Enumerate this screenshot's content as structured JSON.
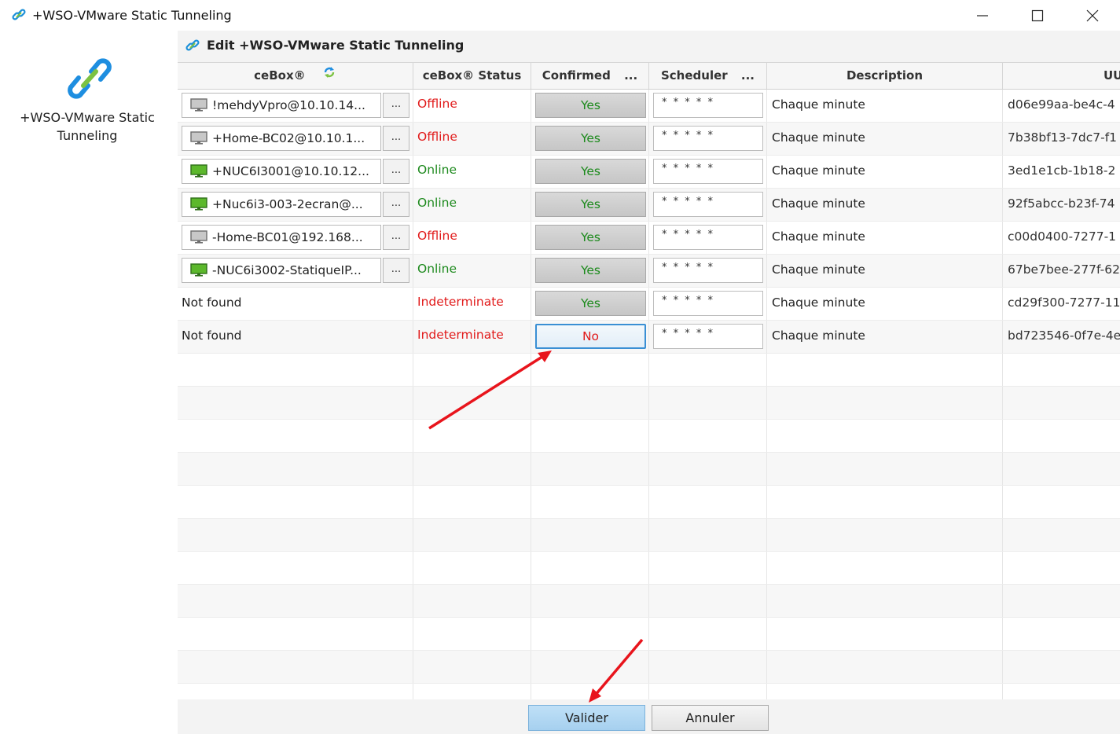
{
  "window": {
    "title": "+WSO-VMware Static Tunneling"
  },
  "sidebar": {
    "label_line1": "+WSO-VMware Static",
    "label_line2": "Tunneling"
  },
  "panel": {
    "title": "Edit +WSO-VMware Static Tunneling"
  },
  "columns": {
    "cebox": "ceBox®",
    "status": "ceBox® Status",
    "confirmed": "Confirmed",
    "scheduler": "Scheduler",
    "description": "Description",
    "uuid": "UU",
    "more": "..."
  },
  "rows": [
    {
      "cebox": "!mehdyVpro@10.10.14...",
      "online": false,
      "status": "Offline",
      "confirmed": "Yes",
      "scheduler": "* * * * *",
      "description": "Chaque minute",
      "uuid": "d06e99aa-be4c-4"
    },
    {
      "cebox": "+Home-BC02@10.10.1...",
      "online": false,
      "status": "Offline",
      "confirmed": "Yes",
      "scheduler": "* * * * *",
      "description": "Chaque minute",
      "uuid": "7b38bf13-7dc7-f1"
    },
    {
      "cebox": "+NUC6I3001@10.10.12...",
      "online": true,
      "status": "Online",
      "confirmed": "Yes",
      "scheduler": "* * * * *",
      "description": "Chaque minute",
      "uuid": "3ed1e1cb-1b18-2"
    },
    {
      "cebox": "+Nuc6i3-003-2ecran@...",
      "online": true,
      "status": "Online",
      "confirmed": "Yes",
      "scheduler": "* * * * *",
      "description": "Chaque minute",
      "uuid": "92f5abcc-b23f-74"
    },
    {
      "cebox": "-Home-BC01@192.168...",
      "online": false,
      "status": "Offline",
      "confirmed": "Yes",
      "scheduler": "* * * * *",
      "description": "Chaque minute",
      "uuid": "c00d0400-7277-1"
    },
    {
      "cebox": "-NUC6i3002-StatiqueIP...",
      "online": true,
      "status": "Online",
      "confirmed": "Yes",
      "scheduler": "* * * * *",
      "description": "Chaque minute",
      "uuid": "67be7bee-277f-62"
    },
    {
      "cebox": "Not found",
      "online": null,
      "status": "Indeterminate",
      "confirmed": "Yes",
      "scheduler": "* * * * *",
      "description": "Chaque minute",
      "uuid": "cd29f300-7277-11"
    },
    {
      "cebox": "Not found",
      "online": null,
      "status": "Indeterminate",
      "confirmed": "No",
      "scheduler": "* * * * *",
      "description": "Chaque minute",
      "uuid": "bd723546-0f7e-4e"
    }
  ],
  "buttons": {
    "validate": "Valider",
    "cancel": "Annuler",
    "cell_more": "..."
  },
  "colors": {
    "offline": "#e11a1a",
    "online": "#1e8a1e",
    "accent": "#3a8fd4",
    "annotation_arrow": "#e8141c"
  }
}
